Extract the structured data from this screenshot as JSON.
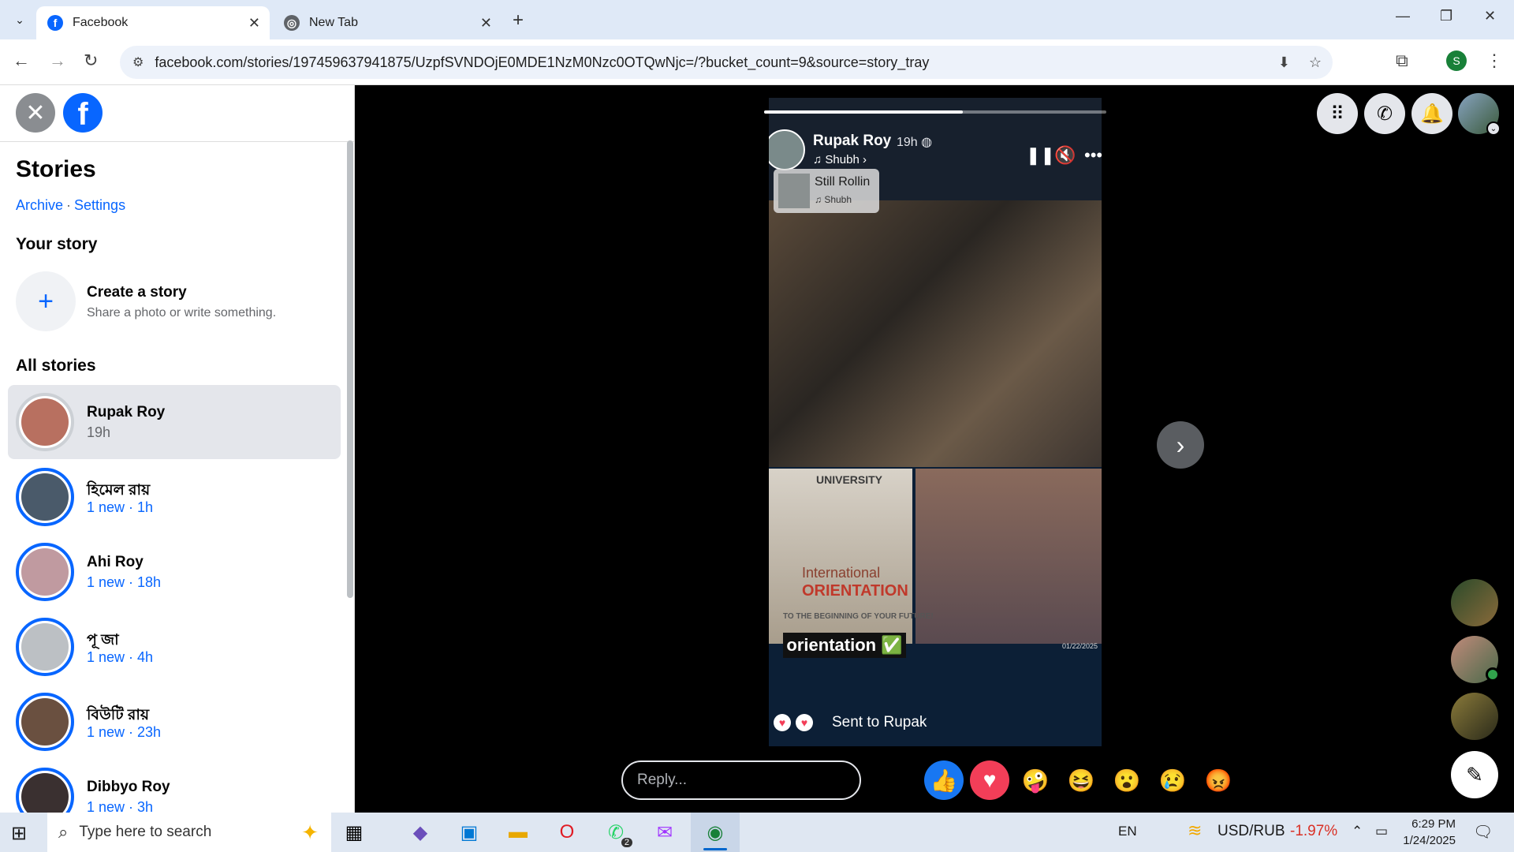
{
  "browser": {
    "tabs": [
      {
        "title": "Facebook",
        "active": true
      },
      {
        "title": "New Tab",
        "active": false
      }
    ],
    "url": "facebook.com/stories/197459637941875/UzpfSVNDOjE0MDE1NzM0Nzc0OTQwNjc=/?bucket_count=9&source=story_tray",
    "profile_initial": "S"
  },
  "sidebar": {
    "title": "Stories",
    "archive_link": "Archive",
    "separator": "·",
    "settings_link": "Settings",
    "your_story_heading": "Your story",
    "create_title": "Create a story",
    "create_subtitle": "Share a photo or write something.",
    "all_stories_heading": "All stories",
    "stories": [
      {
        "name": "Rupak Roy",
        "meta": "19h",
        "selected": true,
        "color": "#b87060"
      },
      {
        "name": "হিমেল রায়",
        "meta": "1 new · 1h",
        "selected": false,
        "color": "#4a5a6a"
      },
      {
        "name": "Ahi Roy",
        "meta": "1 new · 18h",
        "selected": false,
        "color": "#c09aa0"
      },
      {
        "name": "পূ জা",
        "meta": "1 new · 4h",
        "selected": false,
        "color": "#bcc0c4"
      },
      {
        "name": "বিউটি রায়",
        "meta": "1 new · 23h",
        "selected": false,
        "color": "#6a5040"
      },
      {
        "name": "Dibbyo Roy",
        "meta": "1 new · 3h",
        "selected": false,
        "color": "#3a3030"
      }
    ]
  },
  "story": {
    "author": "Rupak Roy",
    "time": "19h",
    "music_label": "♫ Shubh ›",
    "sticker_title": "Still Rollin",
    "sticker_artist": "♫ Shubh",
    "photo_text_university": "UNIVERSITY",
    "photo_text_international": "International",
    "photo_text_orientation": "ORIENTATION",
    "photo_text_tagline": "TO THE BEGINNING OF YOUR FUTURE!",
    "caption": "orientation ✅",
    "photo_date": "01/22/2025",
    "sent_text": "Sent to Rupak",
    "progress": 0.58
  },
  "reply_placeholder": "Reply...",
  "reactions": [
    {
      "name": "like",
      "glyph": "👍",
      "bg": "#1877f2"
    },
    {
      "name": "love",
      "glyph": "♥",
      "bg": "#f33e58"
    },
    {
      "name": "care",
      "glyph": "🤪",
      "bg": "transparent"
    },
    {
      "name": "haha",
      "glyph": "😆",
      "bg": "transparent"
    },
    {
      "name": "wow",
      "glyph": "😮",
      "bg": "transparent"
    },
    {
      "name": "sad",
      "glyph": "😢",
      "bg": "transparent"
    },
    {
      "name": "angry",
      "glyph": "😡",
      "bg": "transparent"
    }
  ],
  "taskbar": {
    "search_placeholder": "Type here to search",
    "whatsapp_badge": "2",
    "lang": "EN",
    "ticker": "USD/RUB",
    "ticker_change": "-1.97%",
    "time": "6:29 PM",
    "date": "1/24/2025"
  }
}
